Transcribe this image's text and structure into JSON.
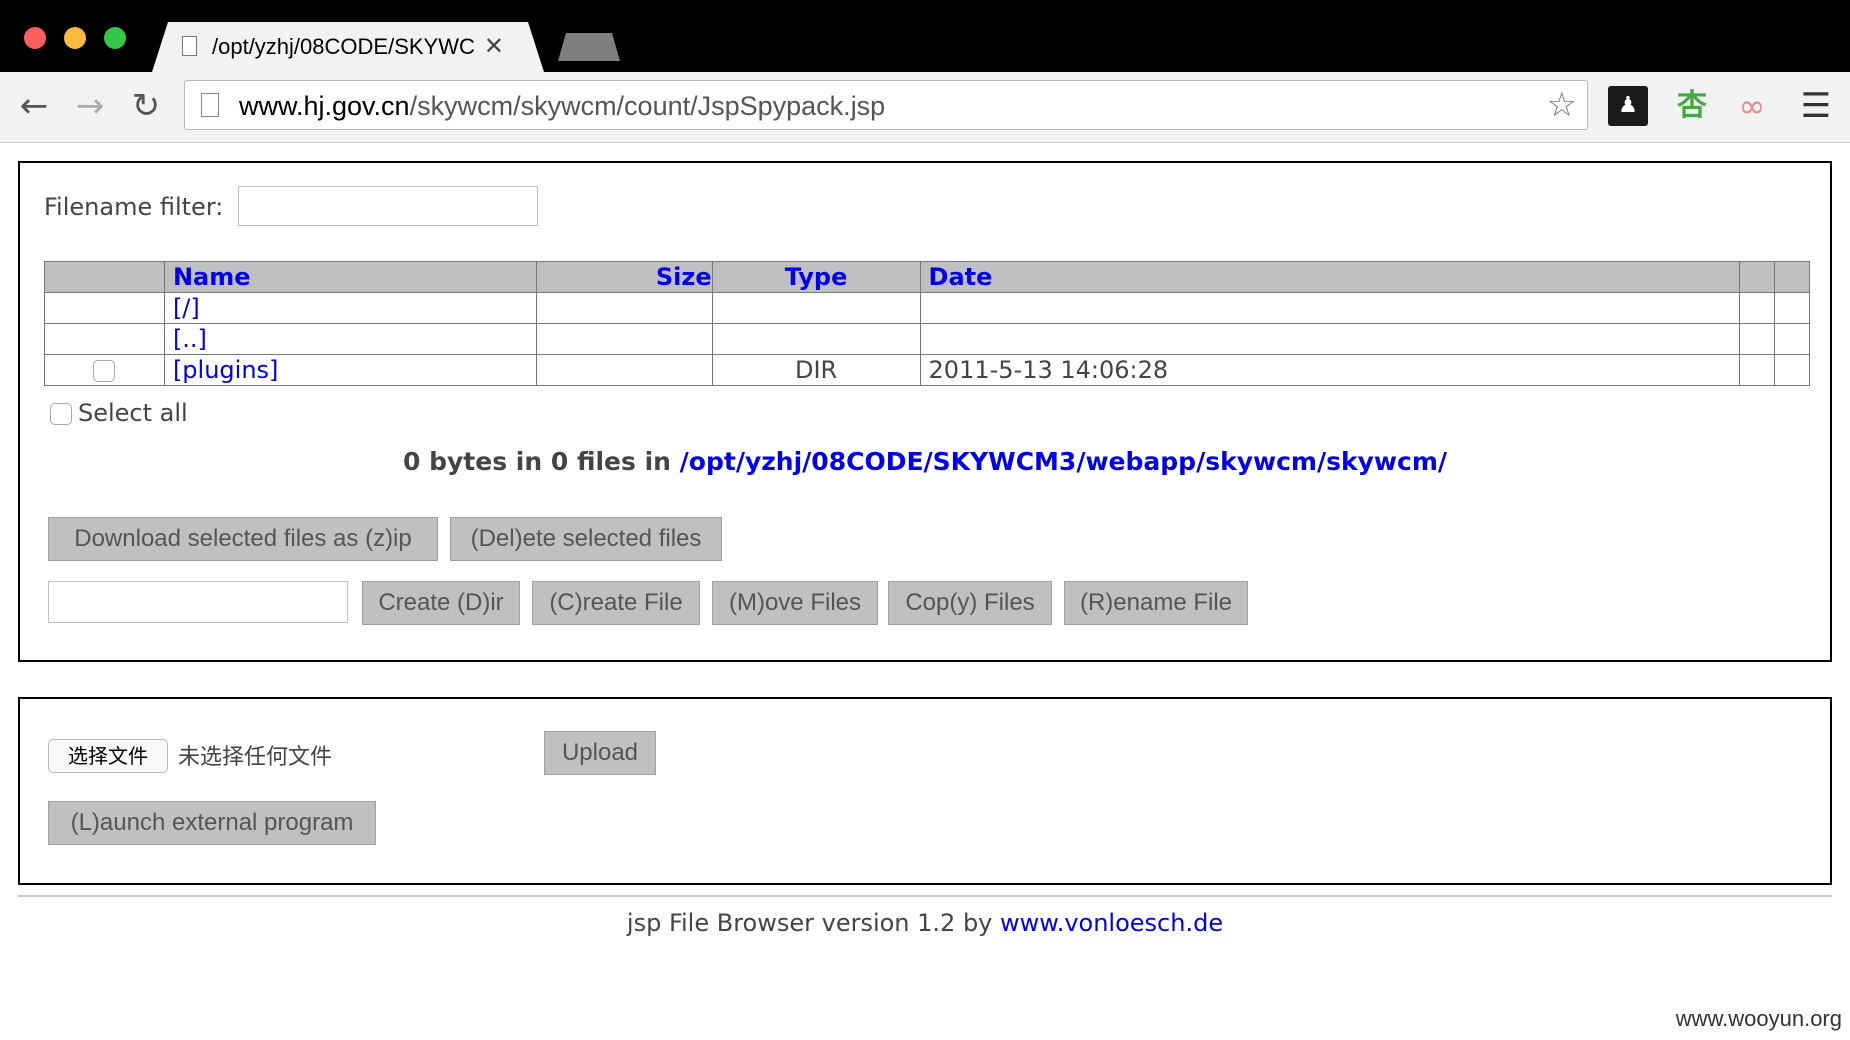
{
  "browser": {
    "tab_title": "/opt/yzhj/08CODE/SKYWC",
    "close_glyph": "✕",
    "url_host": "www.hj.gov.cn",
    "url_path": "/skywcm/skywcm/count/JspSpypack.jsp",
    "back_glyph": "←",
    "forward_glyph": "→",
    "reload_glyph": "C",
    "star_glyph": "☆",
    "ext1_glyph": "👤",
    "ext2_glyph": "杏",
    "ext3_glyph": "∞",
    "menu_glyph": "☰"
  },
  "filter": {
    "label": "Filename filter:",
    "value": ""
  },
  "table": {
    "headers": [
      "",
      "Name",
      "Size",
      "Type",
      "Date",
      "",
      ""
    ],
    "rows": [
      {
        "name": "[/]",
        "size": "",
        "type": "",
        "date": ""
      },
      {
        "name": "[..]",
        "size": "",
        "type": "",
        "date": ""
      },
      {
        "name": "[plugins]",
        "size": "",
        "type": "DIR",
        "date": "2011-5-13 14:06:28"
      }
    ]
  },
  "select_all_label": "Select all",
  "summary": {
    "prefix": "0 bytes in 0 files in ",
    "path": "/opt/yzhj/08CODE/SKYWCM3/webapp/skywcm/skywcm/"
  },
  "actions": {
    "zip": "Download selected files as (z)ip",
    "delete": "(Del)ete selected files",
    "mkdir": "Create (D)ir",
    "mkfile": "(C)reate File",
    "move": "(M)ove Files",
    "copy": "Cop(y) Files",
    "rename": "(R)ename File",
    "name_input_value": ""
  },
  "upload": {
    "choose_label": "选择文件",
    "no_file_text": "未选择任何文件",
    "upload_label": "Upload",
    "launch_label": "(L)aunch external program"
  },
  "footer": {
    "text": "jsp File Browser version 1.2 by ",
    "link": "www.vonloesch.de"
  },
  "watermark": "www.wooyun.org"
}
